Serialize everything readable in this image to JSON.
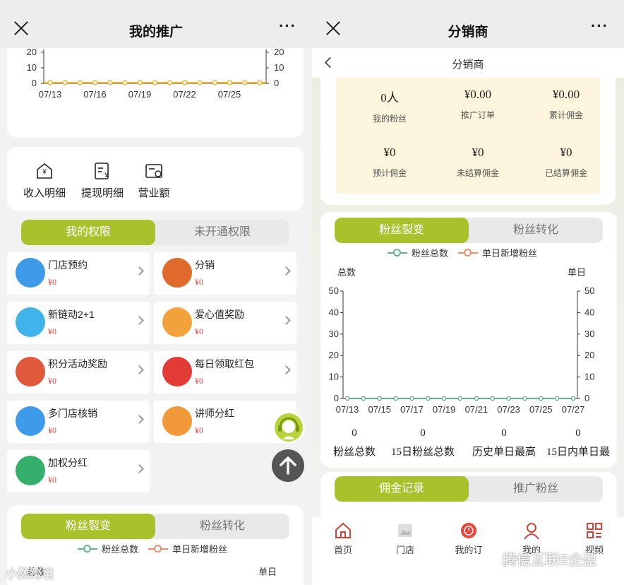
{
  "left": {
    "topbar": {
      "title": "我的推广"
    },
    "top_chart": {
      "y_ticks": [
        "20",
        "10",
        "0"
      ],
      "x_ticks": [
        "07/13",
        "07/16",
        "07/19",
        "07/22",
        "07/25"
      ]
    },
    "quick_links": [
      {
        "label": "收入明细",
        "icon": "wallet-yen-icon"
      },
      {
        "label": "提现明细",
        "icon": "receipt-yen-icon"
      },
      {
        "label": "营业额",
        "icon": "revenue-icon"
      }
    ],
    "perm_tabs": [
      "我的权限",
      "未开通权限"
    ],
    "permissions": [
      {
        "name": "门店预约",
        "amount": "¥0",
        "icon": "store-upload-icon",
        "color": "#3d9be9"
      },
      {
        "name": "分销",
        "amount": "¥0",
        "icon": "distribution-tree-icon",
        "color": "#e06a2b"
      },
      {
        "name": "新链动2+1",
        "amount": "¥0",
        "icon": "cloud-link-icon",
        "color": "#3fb3ea"
      },
      {
        "name": "爱心值奖励",
        "amount": "¥0",
        "icon": "heart-reward-icon",
        "color": "#f2a23a"
      },
      {
        "name": "积分活动奖励",
        "amount": "¥0",
        "icon": "points-badge-icon",
        "color": "#e0593d"
      },
      {
        "name": "每日领取红包",
        "amount": "¥0",
        "icon": "red-packet-icon",
        "color": "#e23b36"
      },
      {
        "name": "多门店核销",
        "amount": "¥0",
        "icon": "multi-store-icon",
        "color": "#3d9be9"
      },
      {
        "name": "讲师分红",
        "amount": "¥0",
        "icon": "lecturer-icon",
        "color": "#f29a3a"
      },
      {
        "name": "加权分红",
        "amount": "¥0",
        "icon": "pie-user-icon",
        "color": "#34b06a"
      }
    ],
    "fans_tabs": [
      "粉丝裂变",
      "粉丝转化"
    ],
    "legend": [
      "粉丝总数",
      "单日新增粉丝"
    ],
    "axis_left": "总数",
    "axis_right": "单日",
    "watermark": "小数跨境"
  },
  "right": {
    "topbar": {
      "title": "分销商"
    },
    "subheader": {
      "title": "分销商"
    },
    "stats": [
      {
        "value": "0人",
        "label": "我的粉丝"
      },
      {
        "value": "¥0.00",
        "label": "推广订单"
      },
      {
        "value": "¥0.00",
        "label": "累计佣金"
      },
      {
        "value": "¥0",
        "label": "预计佣金"
      },
      {
        "value": "¥0",
        "label": "未结算佣金"
      },
      {
        "value": "¥0",
        "label": "已结算佣金"
      }
    ],
    "fans_tabs": [
      "粉丝裂变",
      "粉丝转化"
    ],
    "legend": [
      "粉丝总数",
      "单日新增粉丝"
    ],
    "chart_data": {
      "type": "line",
      "x": [
        "07/13",
        "07/14",
        "07/15",
        "07/16",
        "07/17",
        "07/18",
        "07/19",
        "07/20",
        "07/21",
        "07/22",
        "07/23",
        "07/24",
        "07/25",
        "07/26",
        "07/27"
      ],
      "x_tick_labels": [
        "07/13",
        "07/15",
        "07/17",
        "07/19",
        "07/21",
        "07/23",
        "07/25",
        "07/27"
      ],
      "series": [
        {
          "name": "粉丝总数",
          "values": [
            0,
            0,
            0,
            0,
            0,
            0,
            0,
            0,
            0,
            0,
            0,
            0,
            0,
            0,
            0
          ],
          "color": "#62b38c"
        },
        {
          "name": "单日新增粉丝",
          "values": [
            0,
            0,
            0,
            0,
            0,
            0,
            0,
            0,
            0,
            0,
            0,
            0,
            0,
            0,
            0
          ],
          "color": "#e9906a"
        }
      ],
      "ylabel_left": "总数",
      "ylabel_right": "单日",
      "ylim": [
        0,
        50
      ],
      "y_ticks": [
        50,
        40,
        30,
        20,
        10,
        0
      ],
      "grid": false,
      "legend_position": "top"
    },
    "summary": [
      {
        "value": "0",
        "label": "粉丝总数"
      },
      {
        "value": "0",
        "label": "15日粉丝总数"
      },
      {
        "value": "0",
        "label": "历史单日最高"
      },
      {
        "value": "0",
        "label": "15日内单日最"
      }
    ],
    "record_tabs": [
      "佣金记录",
      "推广粉丝"
    ],
    "nav": [
      {
        "label": "首页",
        "icon": "home-icon"
      },
      {
        "label": "门店",
        "icon": "store-image-icon"
      },
      {
        "label": "我的订",
        "icon": "orders-icon"
      },
      {
        "label": "我的",
        "icon": "user-icon"
      },
      {
        "label": "视频",
        "icon": "video-grid-icon"
      }
    ],
    "watermark": "腾信互联E企盈",
    "colors": {
      "accent": "#a8c22b",
      "stat_bg": "#fdf6dc"
    }
  }
}
